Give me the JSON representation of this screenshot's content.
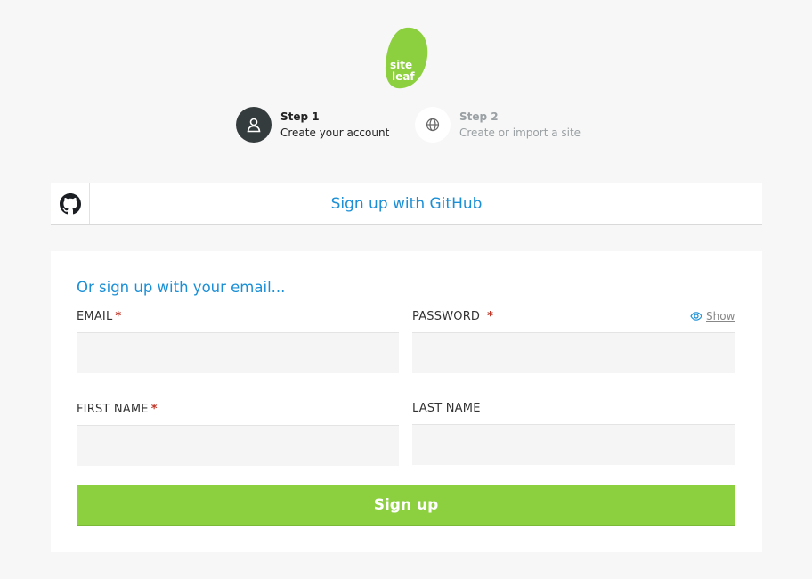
{
  "logo": {
    "text_line1": "site",
    "text_line2": "leaf",
    "color": "#8ccf3f"
  },
  "steps": [
    {
      "title": "Step 1",
      "subtitle": "Create your account",
      "icon": "user-icon",
      "active": true
    },
    {
      "title": "Step 2",
      "subtitle": "Create or import a site",
      "icon": "globe-icon",
      "active": false
    }
  ],
  "github": {
    "label": "Sign up with GitHub",
    "icon": "github-icon"
  },
  "form": {
    "heading": "Or sign up with your email...",
    "email": {
      "label": "EMAIL",
      "required_mark": "*",
      "value": ""
    },
    "password": {
      "label": "PASSWORD",
      "required_mark": "*",
      "value": "",
      "show_label": "Show",
      "show_icon": "eye-icon"
    },
    "first_name": {
      "label": "FIRST NAME",
      "required_mark": "*",
      "value": ""
    },
    "last_name": {
      "label": "LAST NAME",
      "value": ""
    },
    "submit_label": "Sign up"
  },
  "colors": {
    "accent_blue": "#1a8fd6",
    "button_green": "#8ccf3f",
    "required_red": "#c0392b",
    "step_active_bg": "#353c3e"
  }
}
